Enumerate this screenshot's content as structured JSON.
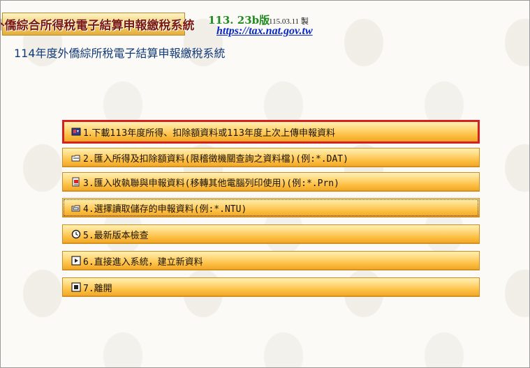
{
  "header": {
    "logo_text": "外僑綜合所得稅電子結算申報繳稅系統",
    "version": "113. 23b版",
    "build_date": "115.03.11 製",
    "url": "https://tax.nat.gov.tw"
  },
  "page": {
    "title": "114年度外僑綜所稅電子結算申報繳稅系統"
  },
  "menu": {
    "items": [
      {
        "label": "1.下載113年度所得、扣除額資料或113年度上次上傳申報資料",
        "icon": "download-shield-icon",
        "selected": true
      },
      {
        "label": "2.匯入所得及扣除額資料(限稽徵機關查詢之資料檔)(例:*.DAT)",
        "icon": "import-folder-icon",
        "selected": false
      },
      {
        "label": "3.匯入收執聯與申報資料(移轉其他電腦列印使用)(例:*.Prn)",
        "icon": "import-document-icon",
        "selected": false
      },
      {
        "label": "4.選擇讀取儲存的申報資料(例:*.NTU)",
        "icon": "open-file-icon",
        "selected": false
      },
      {
        "label": "5.最新版本檢查",
        "icon": "clock-update-icon",
        "selected": false
      },
      {
        "label": "6.直接進入系統，建立新資料",
        "icon": "play-arrow-icon",
        "selected": false
      },
      {
        "label": "7.離開",
        "icon": "stop-square-icon",
        "selected": false
      }
    ]
  },
  "colors": {
    "selected_border": "#d6201e",
    "button_top": "#fff0b6",
    "button_bottom": "#f0a628",
    "title_text": "#123a78",
    "version_text": "#218a21",
    "url_text": "#0a28c8",
    "logo_text": "#7a1b12"
  }
}
